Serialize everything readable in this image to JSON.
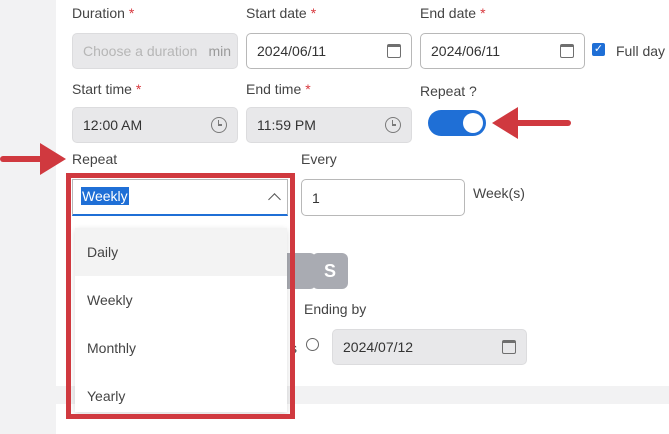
{
  "form": {
    "duration": {
      "label": "Duration",
      "required_mark": "*",
      "placeholder": "Choose a duration",
      "unit": "min"
    },
    "start_date": {
      "label": "Start date",
      "required_mark": "*",
      "value": "2024/06/11",
      "icon": "calendar-icon"
    },
    "end_date": {
      "label": "End date",
      "required_mark": "*",
      "value": "2024/06/11",
      "icon": "calendar-icon"
    },
    "full_day": {
      "label": "Full day",
      "checked": true
    },
    "start_time": {
      "label": "Start time",
      "required_mark": "*",
      "value": "12:00 AM",
      "icon": "clock-icon"
    },
    "end_time": {
      "label": "End time",
      "required_mark": "*",
      "value": "11:59 PM",
      "icon": "clock-icon"
    },
    "repeat_toggle": {
      "label": "Repeat ?",
      "on": true
    },
    "repeat": {
      "label": "Repeat",
      "selected": "Weekly",
      "options": [
        "Daily",
        "Weekly",
        "Monthly",
        "Yearly"
      ]
    },
    "every": {
      "label": "Every",
      "value": "1",
      "unit": "Week(s)"
    },
    "day_button": {
      "label": "S"
    },
    "ending_by": {
      "label": "Ending by",
      "partial_text": "s",
      "value": "2024/07/12",
      "icon": "calendar-icon"
    }
  },
  "annotations": {
    "color": "#d0393f"
  },
  "colors": {
    "accent": "#1f6fd6",
    "required": "#d8383e"
  }
}
